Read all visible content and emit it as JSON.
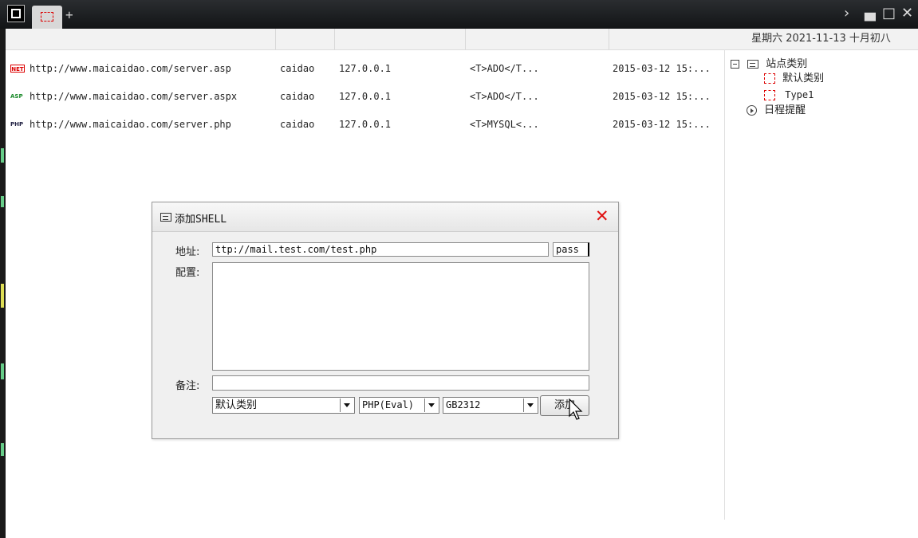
{
  "datetime": "星期六 2021-11-13 十月初八",
  "shells": [
    {
      "icon": "NET",
      "url": "http://www.maicaidao.com/server.asp",
      "password": "caidao",
      "ip": "127.0.0.1",
      "config": "<T>ADO</T...",
      "date": "2015-03-12 15:..."
    },
    {
      "icon": "ASP",
      "url": "http://www.maicaidao.com/server.aspx",
      "password": "caidao",
      "ip": "127.0.0.1",
      "config": "<T>ADO</T...",
      "date": "2015-03-12 15:..."
    },
    {
      "icon": "PHP",
      "url": "http://www.maicaidao.com/server.php",
      "password": "caidao",
      "ip": "127.0.0.1",
      "config": "<T>MYSQL<...",
      "date": "2015-03-12 15:..."
    }
  ],
  "tree": {
    "root": "站点类别",
    "children": [
      "默认类别",
      "Type1"
    ],
    "schedule": "日程提醒"
  },
  "dialog": {
    "title": "添加SHELL",
    "address_label": "地址:",
    "address_value": "ttp://mail.test.com/test.php",
    "password_value": "pass",
    "config_label": "配置:",
    "config_value": "",
    "note_label": "备注:",
    "note_value": "",
    "category_selected": "默认类别",
    "script_selected": "PHP(Eval)",
    "encoding_selected": "GB2312",
    "add_button": "添加"
  },
  "colors": {
    "accent_red": "#e01010",
    "titlebar": "#1a1c1e"
  }
}
